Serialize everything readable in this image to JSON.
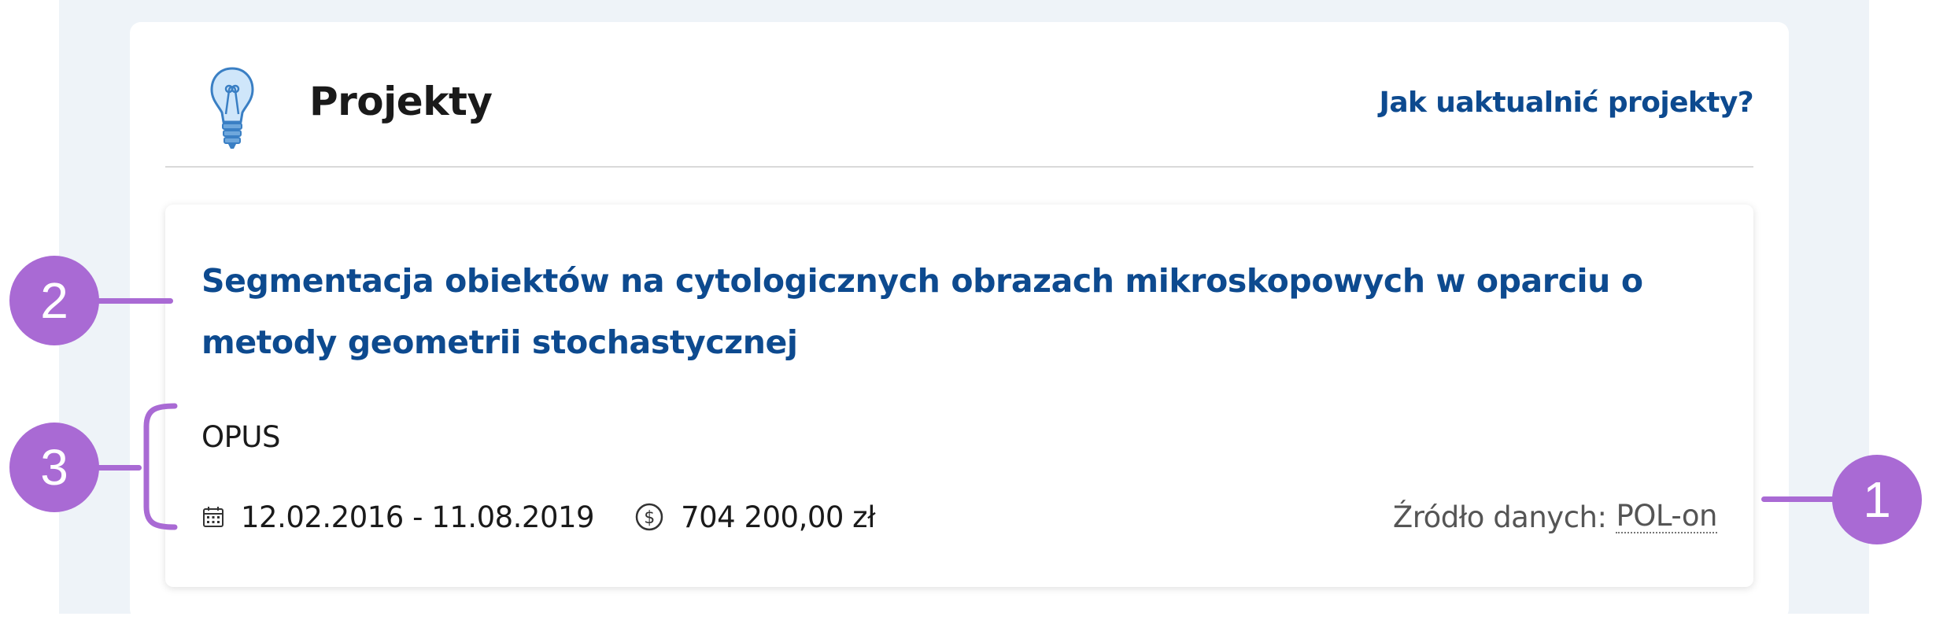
{
  "header": {
    "title": "Projekty",
    "help_link": "Jak uaktualnić projekty?",
    "icon": "lightbulb-icon"
  },
  "project": {
    "title": "Segmentacja obiektów na cytologicznych obrazach mikroskopowych w oparciu o metody geometrii stochastycznej",
    "program": "OPUS",
    "date_range": "12.02.2016 - 11.08.2019",
    "amount": "704 200,00 zł",
    "source_label": "Źródło danych:",
    "source_value": "POL-on"
  },
  "annotations": {
    "callout_1": "1",
    "callout_2": "2",
    "callout_3": "3"
  },
  "colors": {
    "link": "#0d4a8f",
    "callout": "#a96ad4",
    "page_background": "#eef3f8"
  }
}
